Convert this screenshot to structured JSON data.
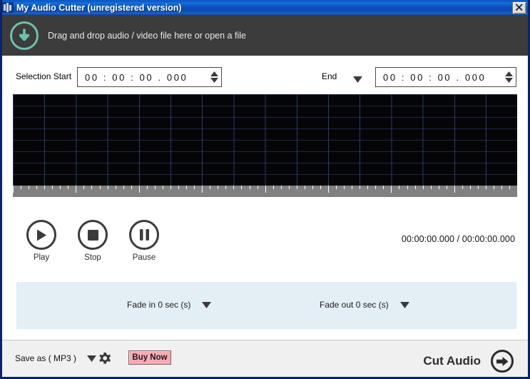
{
  "window": {
    "title": "My Audio Cutter (unregistered version)",
    "close_label": "X",
    "icon": "audio-wave-icon"
  },
  "drop_area": {
    "icon": "download-arrow-circle-icon",
    "text": "Drag and drop audio / video file here or open a file",
    "bg_color": "#3c3c3c",
    "icon_color": "#6cc2ac"
  },
  "selection": {
    "start_label": "Selection Start",
    "start_value": "00 : 00 : 00 . 000",
    "end_label": "End",
    "end_value": "00 : 00 : 00 . 000",
    "spinner_icon": "up-down-spinner-icon",
    "end_dropdown_icon": "chevron-down-icon"
  },
  "waveform": {
    "bg_color": "#050508",
    "grid_color": "#2b3c66",
    "ruler_color": "#808080"
  },
  "transport": {
    "play_label": "Play",
    "stop_label": "Stop",
    "pause_label": "Pause",
    "play_icon": "play-icon",
    "stop_icon": "stop-icon",
    "pause_icon": "pause-icon",
    "timecode": "00:00:00.000 / 00:00:00.000"
  },
  "fade": {
    "panel_color": "#e3eef5",
    "fade_in_label": "Fade in 0 sec (s)",
    "fade_out_label": "Fade out 0 sec (s)",
    "dropdown_icon": "chevron-down-icon"
  },
  "footer": {
    "save_as_label": "Save as ( MP3 )",
    "save_as_dropdown_icon": "chevron-down-icon",
    "settings_icon": "gear-icon",
    "buy_now_label": "Buy Now",
    "buy_now_color": "#f9aab4",
    "cut_audio_label": "Cut Audio",
    "cut_audio_icon": "arrow-right-circle-icon"
  }
}
